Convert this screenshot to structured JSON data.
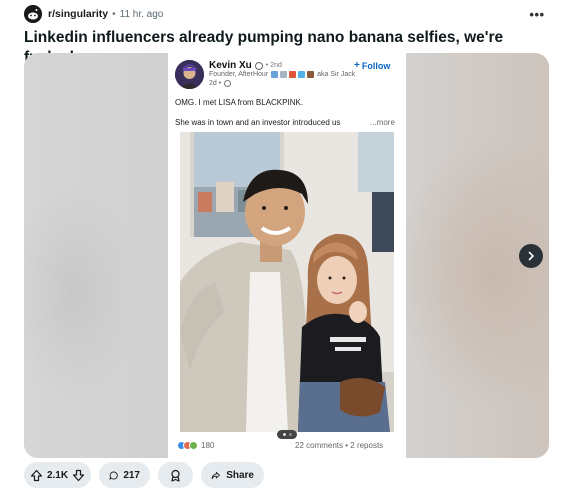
{
  "post": {
    "subreddit": "r/singularity",
    "separator": "•",
    "time": "11 hr. ago",
    "more_label": "•••",
    "title": "Linkedin influencers already pumping nano banana selfies, we're fucked"
  },
  "linkedin": {
    "name": "Kevin Xu",
    "degree": "• 2nd",
    "follow_label": "Follow",
    "follow_plus": "+",
    "headline": "Founder, AfterHour",
    "headline_suffix": "aka Sir Jack",
    "time": "2d •",
    "text_line1": "OMG. I met LISA from BLACKPINK.",
    "text_line2": "She was in town and an investor introduced us",
    "more": "...more",
    "reaction_count": "180",
    "stats": "22 comments  •  2 reposts",
    "accent_color": "#0a66c2"
  },
  "actions": {
    "upvotes": "2.1K",
    "comments": "217",
    "share_label": "Share"
  },
  "icons": [
    "reddit-avatar-icon",
    "more-icon",
    "chevron-right-icon",
    "verified-icon",
    "globe-icon",
    "upvote-icon",
    "downvote-icon",
    "comment-icon",
    "award-icon",
    "share-icon"
  ]
}
